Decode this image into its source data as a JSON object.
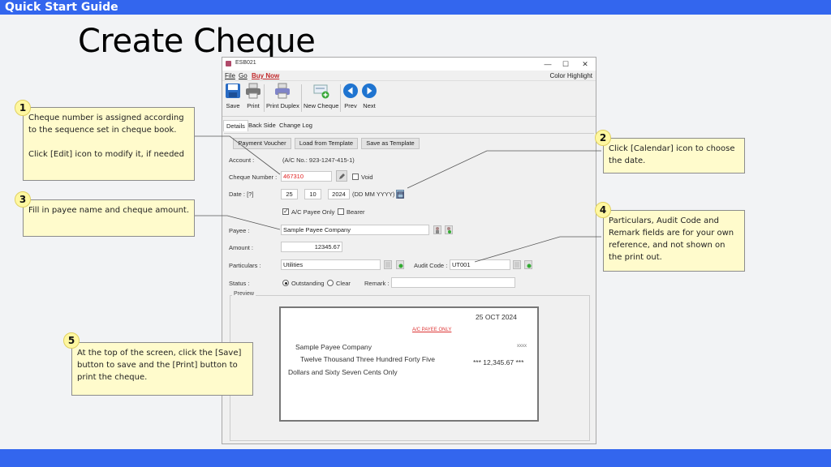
{
  "slide": {
    "header": "Quick Start Guide",
    "title": "Create Cheque"
  },
  "window": {
    "title": "ESB021",
    "controls": {
      "minimize": "—",
      "maximize": "☐",
      "close": "✕"
    },
    "menu": {
      "file": "File",
      "go": "Go",
      "buy_now": "Buy Now",
      "color_highlight": "Color Highlight"
    },
    "toolbar": [
      {
        "label": "Save",
        "icon": "save-icon"
      },
      {
        "label": "Print",
        "icon": "printer-icon"
      },
      {
        "label": "Print Duplex",
        "icon": "printer-duplex-icon"
      },
      {
        "label": "New Cheque",
        "icon": "new-cheque-icon"
      },
      {
        "label": "Prev",
        "icon": "prev-arrow-icon"
      },
      {
        "label": "Next",
        "icon": "next-arrow-icon"
      }
    ],
    "tabs": [
      "Details",
      "Back Side",
      "Change Log"
    ],
    "active_tab": "Details",
    "form": {
      "buttons": {
        "payment_voucher": "Payment Voucher",
        "load_template": "Load from Template",
        "save_template": "Save as Template"
      },
      "account_label": "Account :",
      "account_value": "(A/C No.: 923-1247-415-1)",
      "cheque_number_label": "Cheque Number :",
      "cheque_number": "467310",
      "void_label": "Void",
      "void_checked": false,
      "date_label": "Date : [?]",
      "date_dd": "25",
      "date_mm": "10",
      "date_yyyy": "2024",
      "date_format": "(DD MM YYYY)",
      "ac_payee_only_label": "A/C Payee Only",
      "ac_payee_only_checked": true,
      "bearer_label": "Bearer",
      "bearer_checked": false,
      "payee_label": "Payee :",
      "payee": "Sample Payee Company",
      "amount_label": "Amount :",
      "amount": "12345.67",
      "particulars_label": "Particulars :",
      "particulars": "Utilities",
      "audit_code_label": "Audit Code :",
      "audit_code": "UT001",
      "status_label": "Status :",
      "status_options": [
        "Outstanding",
        "Clear"
      ],
      "status_selected": "Outstanding",
      "remark_label": "Remark :",
      "remark": "",
      "preview_label": "Preview"
    },
    "preview": {
      "date": "25 OCT 2024",
      "ac_payee": "A/C PAYEE ONLY",
      "payee": "Sample Payee Company",
      "xxxx": "xxxx",
      "words_line1": "Twelve Thousand Three Hundred Forty Five",
      "words_line2": "Dollars and Sixty Seven Cents Only",
      "amount_figure": "*** 12,345.67 ***"
    }
  },
  "callouts": [
    {
      "num": "1",
      "text": "Cheque number is assigned according to the sequence set in cheque book.",
      "text2": "Click [Edit] icon to modify it, if needed"
    },
    {
      "num": "2",
      "text": "Click [Calendar] icon to choose the date."
    },
    {
      "num": "3",
      "text": "Fill in payee name and cheque amount."
    },
    {
      "num": "4",
      "text": "Particulars, Audit Code and Remark fields are for your own reference, and not shown on the print out."
    },
    {
      "num": "5",
      "text": "At the top of the screen, click the [Save] button to save and the [Print] button to print the cheque."
    }
  ],
  "colors": {
    "brand_bar": "#3366ee",
    "callout_bg": "#fffbcc",
    "cheque_number": "#e02020",
    "buy_now": "#c0282a"
  }
}
